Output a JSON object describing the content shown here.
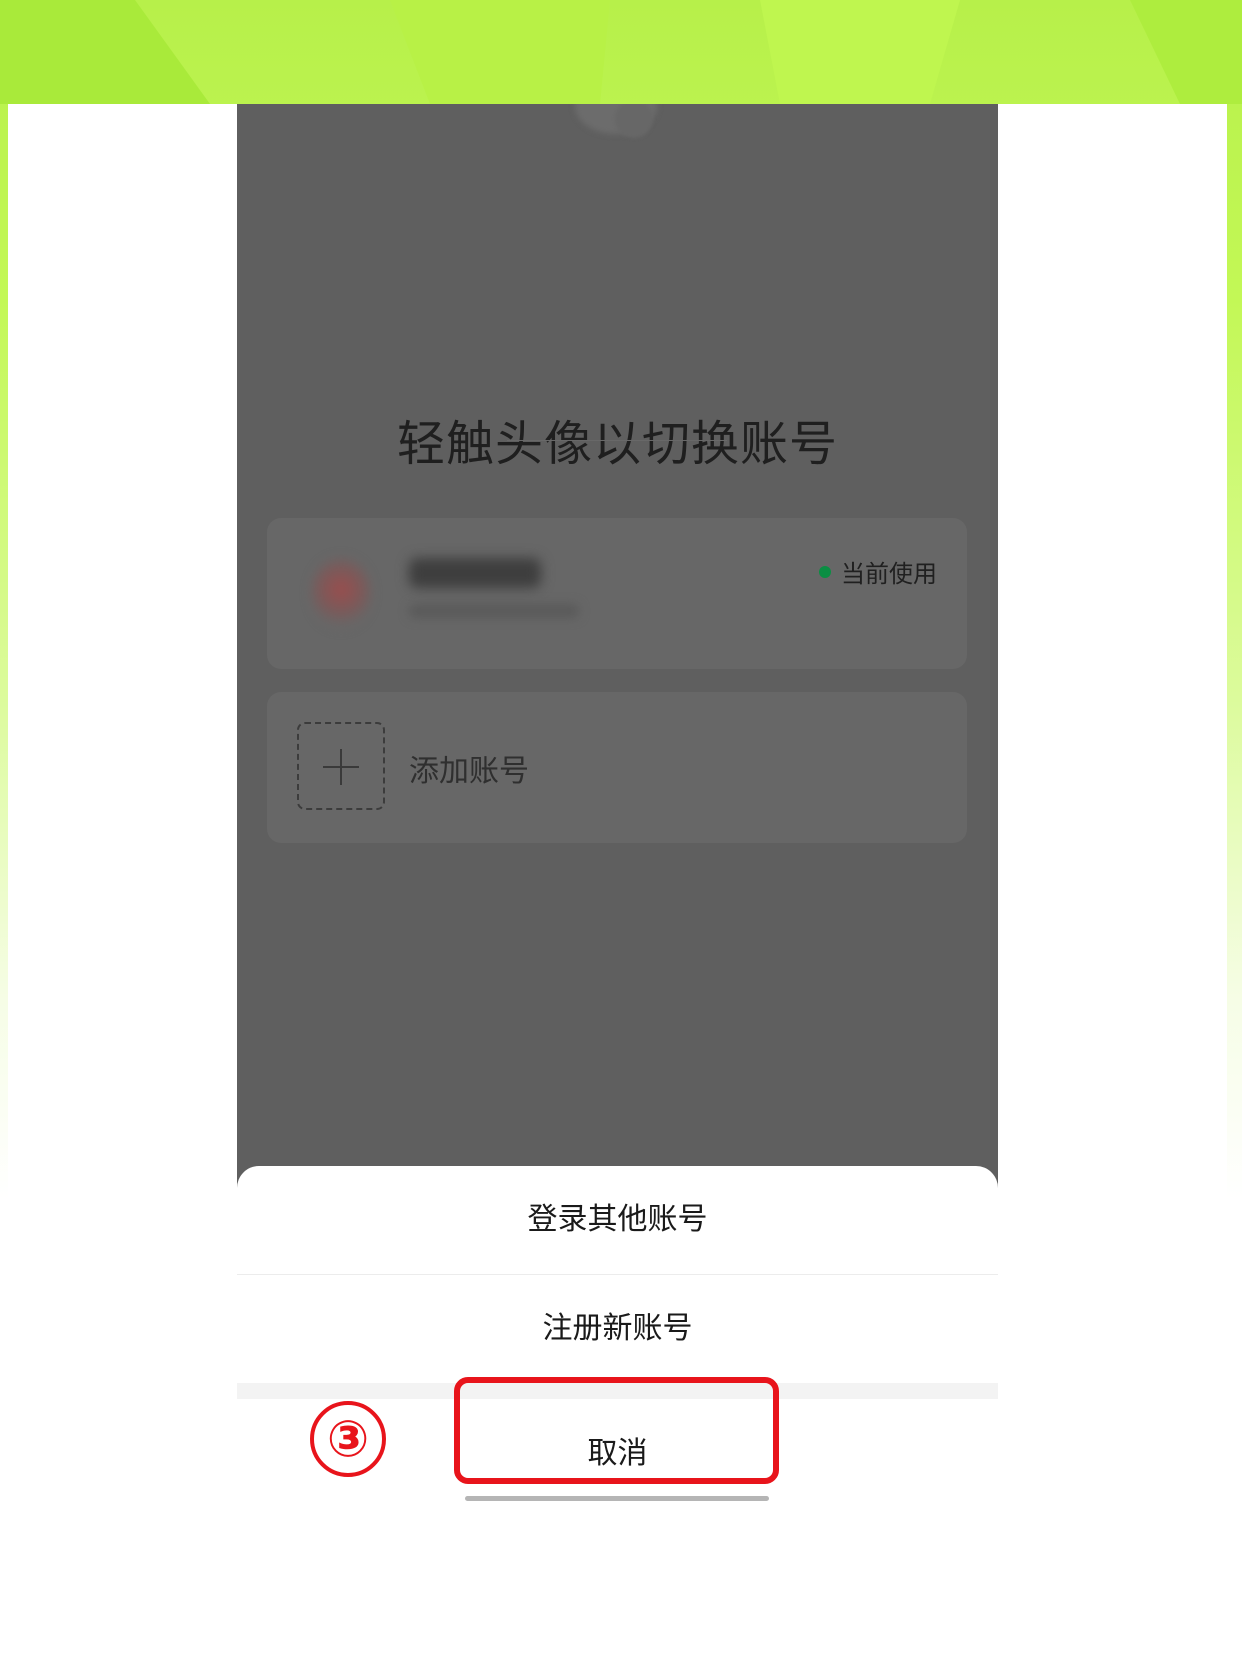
{
  "switch_screen": {
    "title": "轻触头像以切换账号",
    "current_account": {
      "status": "当前使用"
    },
    "add_account_label": "添加账号"
  },
  "action_sheet": {
    "login_other": "登录其他账号",
    "register_new": "注册新账号",
    "cancel": "取消"
  },
  "annotation": {
    "step": "③"
  },
  "colors": {
    "background_green": "#c3f856",
    "status_dot": "#0b8e43",
    "highlight_red": "#e8141b",
    "dim_overlay": "#5f5f5f"
  },
  "icons": {
    "add": "plus-icon",
    "status": "online-dot-icon"
  }
}
